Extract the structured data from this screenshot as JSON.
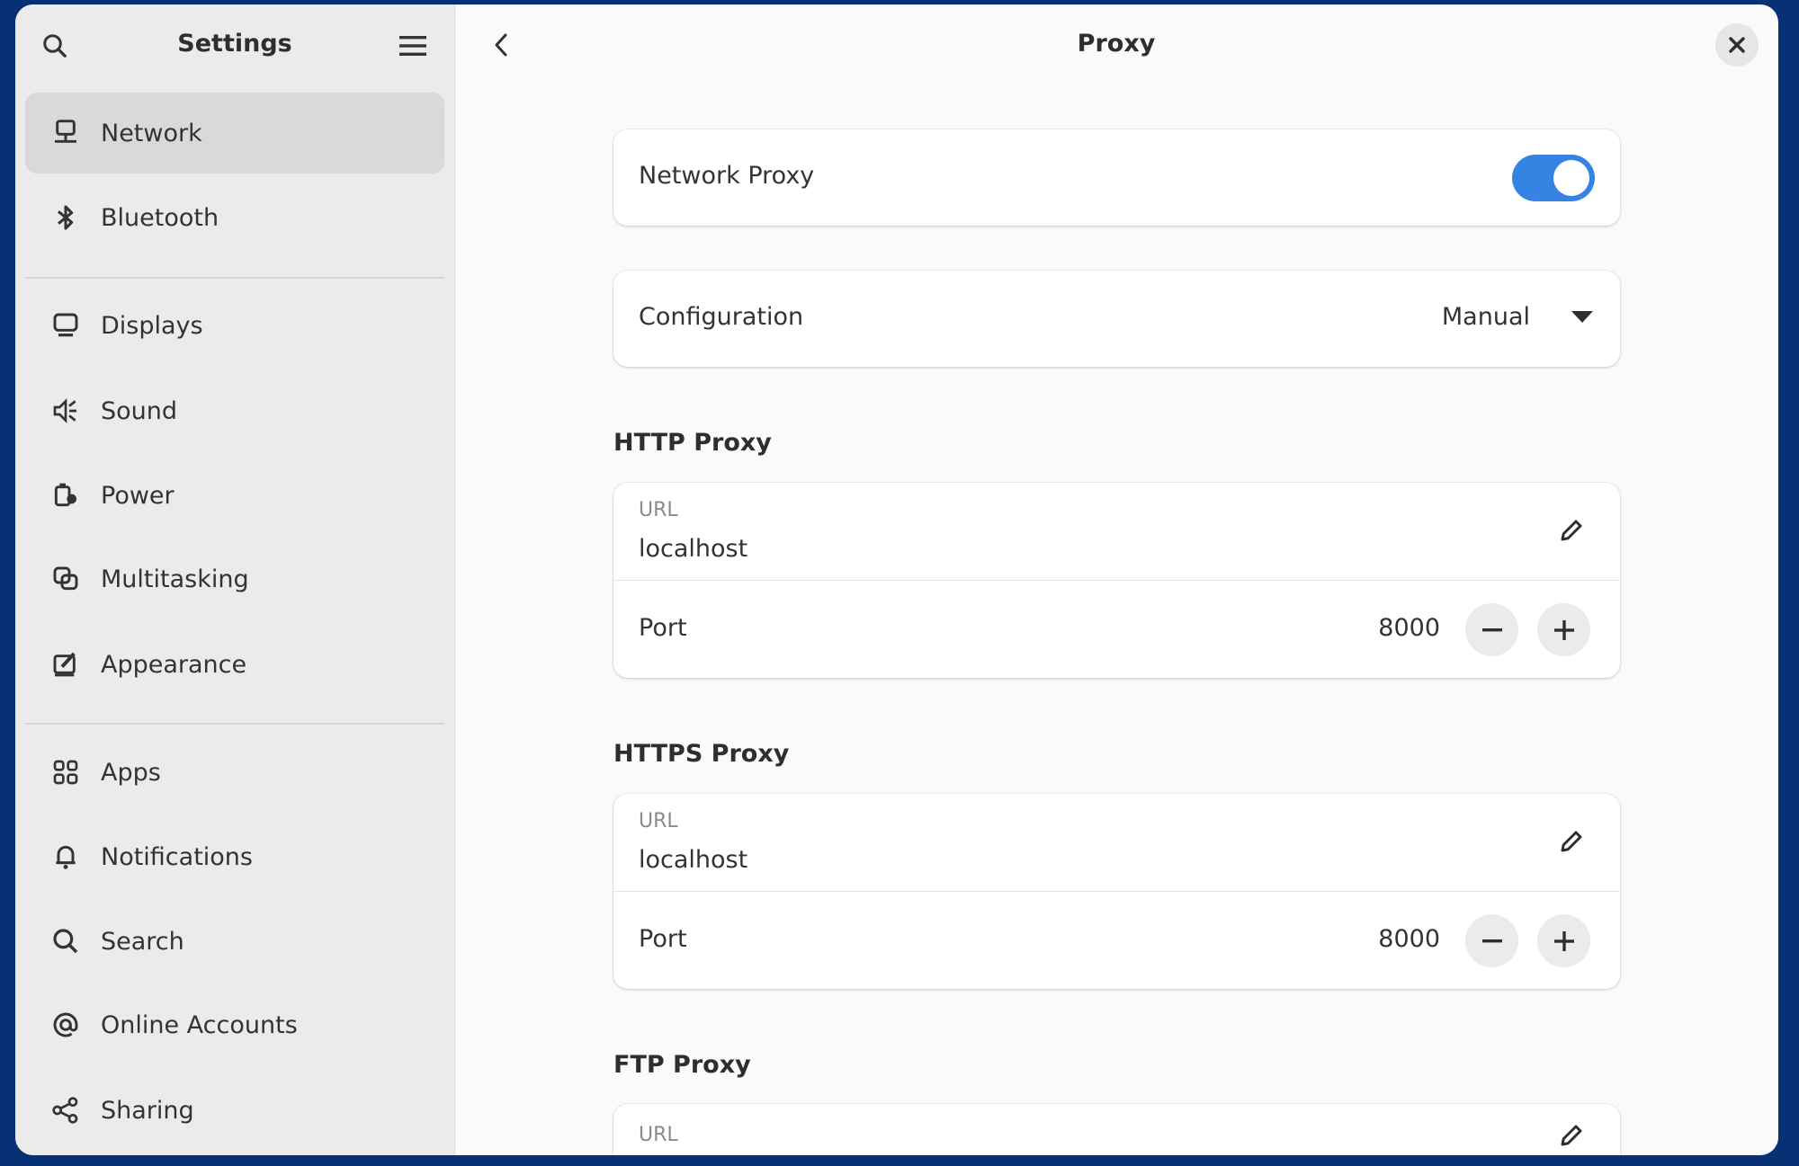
{
  "sidebar": {
    "title": "Settings",
    "items": [
      {
        "label": "Network",
        "icon": "network-icon",
        "selected": true
      },
      {
        "label": "Bluetooth",
        "icon": "bluetooth-icon"
      },
      {
        "label": "Displays",
        "icon": "display-icon"
      },
      {
        "label": "Sound",
        "icon": "speaker-icon"
      },
      {
        "label": "Power",
        "icon": "power-icon"
      },
      {
        "label": "Multitasking",
        "icon": "multitasking-icon"
      },
      {
        "label": "Appearance",
        "icon": "appearance-icon"
      },
      {
        "label": "Apps",
        "icon": "apps-grid-icon"
      },
      {
        "label": "Notifications",
        "icon": "bell-icon"
      },
      {
        "label": "Search",
        "icon": "search-icon"
      },
      {
        "label": "Online Accounts",
        "icon": "at-icon"
      },
      {
        "label": "Sharing",
        "icon": "share-icon"
      }
    ]
  },
  "page": {
    "title": "Proxy"
  },
  "network_proxy": {
    "label": "Network Proxy",
    "enabled": true,
    "accent": "#3584e4"
  },
  "configuration": {
    "label": "Configuration",
    "value": "Manual"
  },
  "http": {
    "heading": "HTTP Proxy",
    "url_label": "URL",
    "url": "localhost",
    "port_label": "Port",
    "port": "8000"
  },
  "https": {
    "heading": "HTTPS Proxy",
    "url_label": "URL",
    "url": "localhost",
    "port_label": "Port",
    "port": "8000"
  },
  "ftp": {
    "heading": "FTP Proxy",
    "url_label": "URL"
  }
}
